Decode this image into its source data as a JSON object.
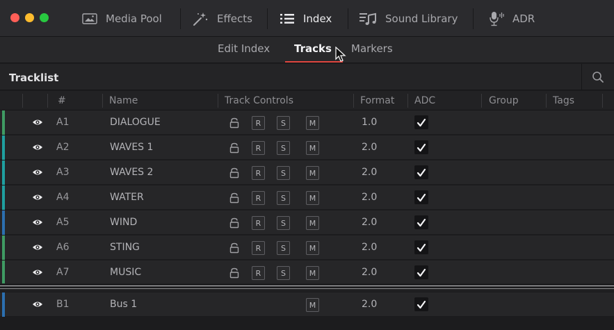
{
  "window": {
    "controls": [
      {
        "name": "close",
        "color": "#ff5f57"
      },
      {
        "name": "minimize",
        "color": "#febc2e"
      },
      {
        "name": "zoom",
        "color": "#28c840"
      }
    ]
  },
  "toolbar": {
    "items": [
      {
        "label": "Media Pool",
        "icon": "media-pool-icon",
        "active": false
      },
      {
        "label": "Effects",
        "icon": "effects-wand-icon",
        "active": false
      },
      {
        "label": "Index",
        "icon": "index-list-icon",
        "active": true
      },
      {
        "label": "Sound Library",
        "icon": "sound-library-icon",
        "active": false
      },
      {
        "label": "ADR",
        "icon": "microphone-icon",
        "active": false
      }
    ]
  },
  "subtabs": {
    "items": [
      {
        "label": "Edit Index",
        "active": false
      },
      {
        "label": "Tracks",
        "active": true
      },
      {
        "label": "Markers",
        "active": false
      }
    ],
    "accent": "#e0463f"
  },
  "tracklist": {
    "title": "Tracklist",
    "search_icon": "search-icon",
    "columns": {
      "num": "#",
      "name": "Name",
      "controls": "Track Controls",
      "format": "Format",
      "adc": "ADC",
      "group": "Group",
      "tags": "Tags"
    },
    "rows": [
      {
        "id": "A1",
        "name": "DIALOGUE",
        "format": "1.0",
        "adc": true,
        "color": "#3f9b63",
        "buttons": [
          "R",
          "S",
          "M"
        ]
      },
      {
        "id": "A2",
        "name": "WAVES 1",
        "format": "2.0",
        "adc": true,
        "color": "#1fa0a0",
        "buttons": [
          "R",
          "S",
          "M"
        ]
      },
      {
        "id": "A3",
        "name": "WAVES 2",
        "format": "2.0",
        "adc": true,
        "color": "#1fa0a0",
        "buttons": [
          "R",
          "S",
          "M"
        ]
      },
      {
        "id": "A4",
        "name": "WATER",
        "format": "2.0",
        "adc": true,
        "color": "#1fa0a0",
        "buttons": [
          "R",
          "S",
          "M"
        ]
      },
      {
        "id": "A5",
        "name": "WIND",
        "format": "2.0",
        "adc": true,
        "color": "#2c6fb0",
        "buttons": [
          "R",
          "S",
          "M"
        ]
      },
      {
        "id": "A6",
        "name": "STING",
        "format": "2.0",
        "adc": true,
        "color": "#3f9b63",
        "buttons": [
          "R",
          "S",
          "M"
        ]
      },
      {
        "id": "A7",
        "name": "MUSIC",
        "format": "2.0",
        "adc": true,
        "color": "#3f9b63",
        "buttons": [
          "R",
          "S",
          "M"
        ]
      }
    ],
    "bus_rows": [
      {
        "id": "B1",
        "name": "Bus 1",
        "format": "2.0",
        "adc": true,
        "color": "#2c6fb0",
        "buttons": [
          "M"
        ]
      }
    ]
  }
}
